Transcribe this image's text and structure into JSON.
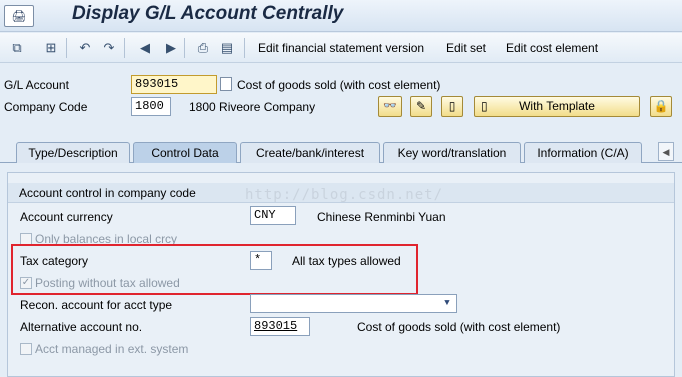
{
  "title_bar": {
    "app_icon": "🖨",
    "title": "Display G/L Account Centrally"
  },
  "toolbar": {
    "items": [
      "Edit financial statement version",
      "Edit set",
      "Edit cost element"
    ],
    "icons": [
      "copy-icon",
      "hierarchy-icon",
      "undo-icon",
      "redo-icon",
      "previous-icon",
      "next-icon",
      "print-icon",
      "document-icon"
    ]
  },
  "header": {
    "gl_account_label": "G/L Account",
    "gl_account_value": "893015",
    "gl_account_desc": "Cost of goods sold (with cost element)",
    "company_code_label": "Company Code",
    "company_code_value": "1800",
    "company_code_desc": "1800 Riveore Company",
    "with_template_label": "With Template"
  },
  "tabs": [
    {
      "label": "Type/Description",
      "active": false
    },
    {
      "label": "Control Data",
      "active": true
    },
    {
      "label": "Create/bank/interest",
      "active": false
    },
    {
      "label": "Key word/translation",
      "active": false
    },
    {
      "label": "Information (C/A)",
      "active": false
    }
  ],
  "panel": {
    "group_title": "Account control in company code",
    "watermark": "http://blog.csdn.net/",
    "account_currency_label": "Account currency",
    "account_currency_value": "CNY",
    "account_currency_desc": "Chinese Renminbi Yuan",
    "only_balances_label": "Only balances in local crcy",
    "tax_category_label": "Tax category",
    "tax_category_value": "*",
    "tax_category_desc": "All tax types allowed",
    "posting_without_tax_label": "Posting without tax allowed",
    "posting_without_tax_checked": "✓",
    "recon_account_label": "Recon. account for acct type",
    "recon_account_value": "",
    "alt_account_label": "Alternative account no.",
    "alt_account_value": "893015",
    "alt_account_desc": "Cost of goods sold (with cost element)",
    "acct_managed_label": "Acct managed in ext. system"
  },
  "colors": {
    "highlight": "#e0242e",
    "button_bg": "#f2dd8a",
    "active_tab": "#bcd1e8"
  }
}
